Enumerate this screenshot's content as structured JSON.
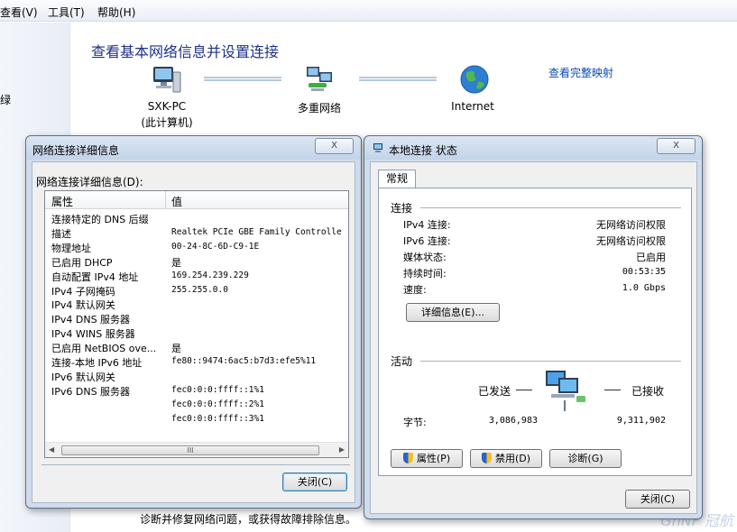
{
  "menu": {
    "view": "查看(V)",
    "tools": "工具(T)",
    "help": "帮助(H)"
  },
  "left_pane": {
    "fragment": "绿"
  },
  "control_panel": {
    "title": "查看基本网络信息并设置连接",
    "full_map_link": "查看完整映射",
    "nodes": [
      {
        "label": "SXK-PC",
        "sublabel": "(此计算机)"
      },
      {
        "label": "多重网络"
      },
      {
        "label": "Internet"
      }
    ],
    "bottom_text": "诊断并修复网络问题，或获得故障排除信息。",
    "watermark": "GhNF 冠航"
  },
  "details_dialog": {
    "title": "网络连接详细信息",
    "close_x": "X",
    "group_label": "网络连接详细信息(D):",
    "columns": [
      "属性",
      "值"
    ],
    "rows": [
      {
        "property": "连接特定的 DNS 后缀",
        "value": ""
      },
      {
        "property": "描述",
        "value": "Realtek PCIe GBE Family Controlle"
      },
      {
        "property": "物理地址",
        "value": "00-24-8C-6D-C9-1E"
      },
      {
        "property": "已启用 DHCP",
        "value": "是"
      },
      {
        "property": "自动配置 IPv4 地址",
        "value": "169.254.239.229"
      },
      {
        "property": "IPv4 子网掩码",
        "value": "255.255.0.0"
      },
      {
        "property": "IPv4 默认网关",
        "value": ""
      },
      {
        "property": "IPv4 DNS 服务器",
        "value": ""
      },
      {
        "property": "IPv4 WINS 服务器",
        "value": ""
      },
      {
        "property": "已启用 NetBIOS ove...",
        "value": "是"
      },
      {
        "property": "连接-本地 IPv6 地址",
        "value": "fe80::9474:6ac5:b7d3:efe5%11"
      },
      {
        "property": "IPv6 默认网关",
        "value": ""
      },
      {
        "property": "IPv6 DNS 服务器",
        "value": "fec0:0:0:ffff::1%1"
      },
      {
        "property": "",
        "value": "fec0:0:0:ffff::2%1"
      },
      {
        "property": "",
        "value": "fec0:0:0:ffff::3%1"
      }
    ],
    "scroll_left": "◀",
    "scroll_right": "▶",
    "scroll_thumb": "III",
    "close_button": "关闭(C)"
  },
  "status_dialog": {
    "title": "本地连接 状态",
    "close_x": "X",
    "tab": "常规",
    "connection_section": "连接",
    "connection_rows": [
      {
        "label": "IPv4 连接:",
        "value": "无网络访问权限"
      },
      {
        "label": "IPv6 连接:",
        "value": "无网络访问权限"
      },
      {
        "label": "媒体状态:",
        "value": "已启用"
      },
      {
        "label": "持续时间:",
        "value": "00:53:35"
      },
      {
        "label": "速度:",
        "value": "1.0 Gbps"
      }
    ],
    "details_button": "详细信息(E)...",
    "activity_section": "活动",
    "sent_label": "已发送",
    "received_label": "已接收",
    "bytes_label": "字节:",
    "bytes_sent": "3,086,983",
    "bytes_received": "9,311,902",
    "properties_button": "属性(P)",
    "disable_button": "禁用(D)",
    "diagnose_button": "诊断(G)",
    "close_button": "关闭(C)"
  }
}
